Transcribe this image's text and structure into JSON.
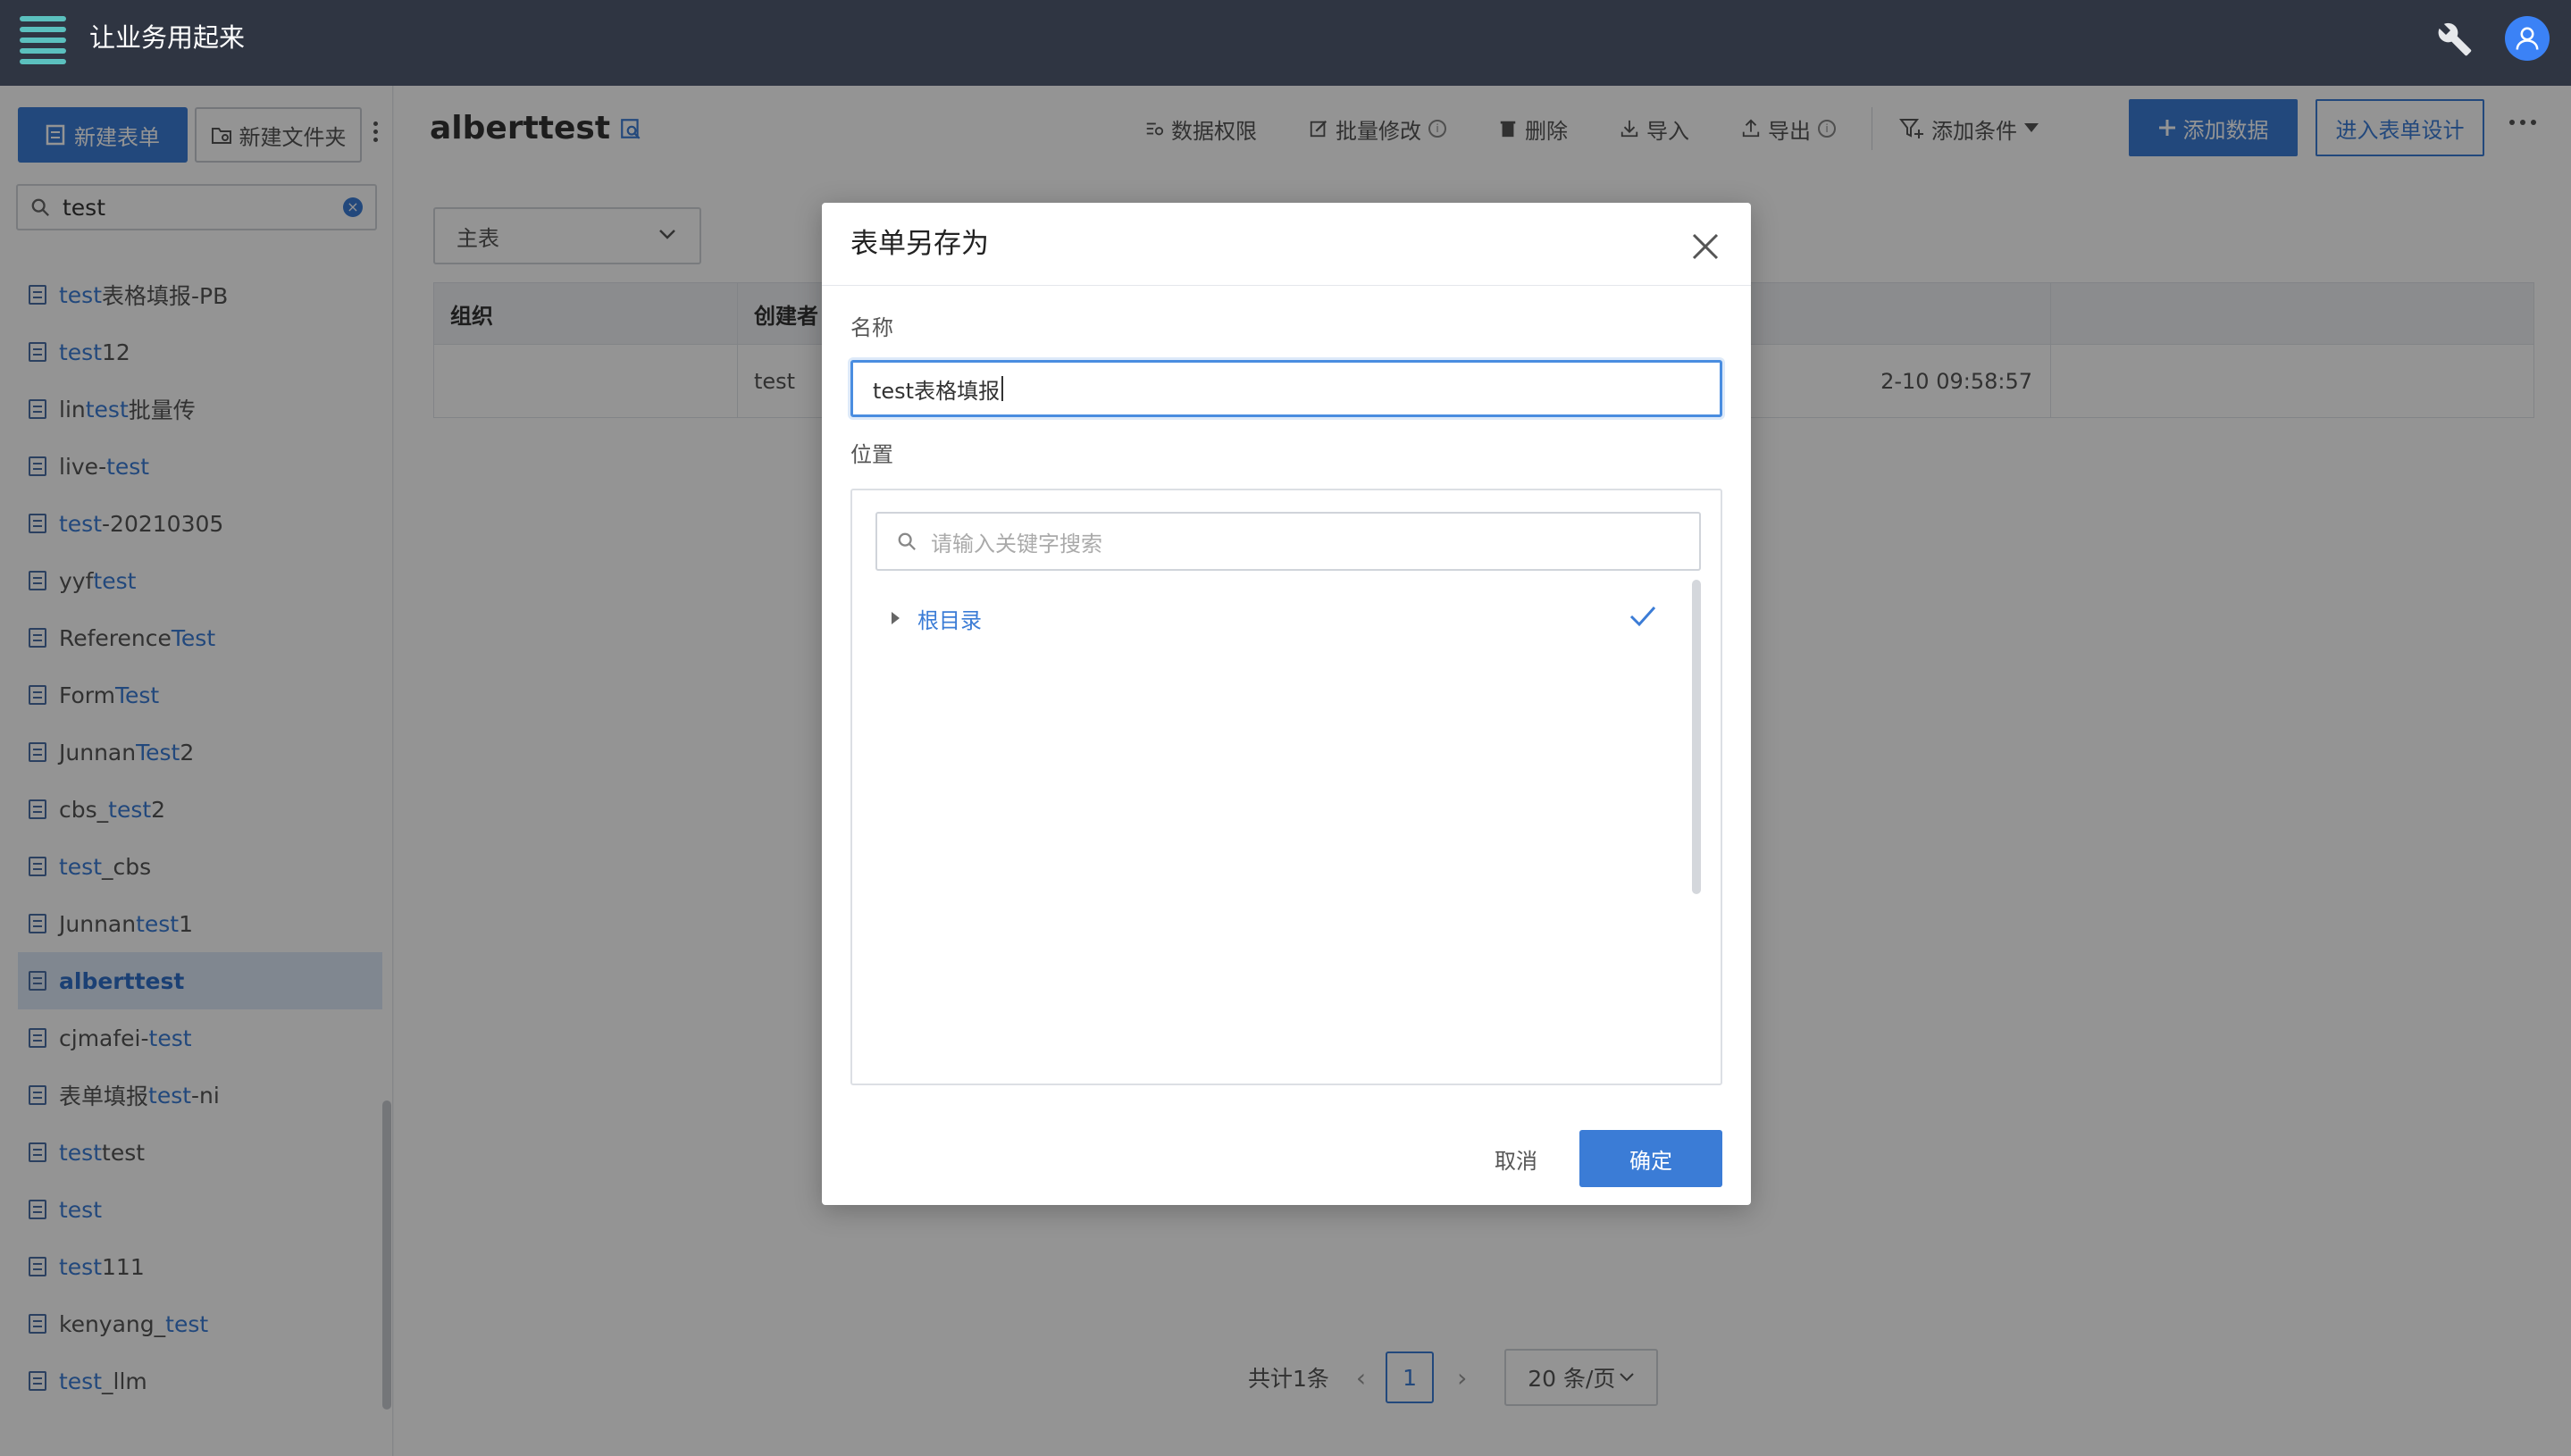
{
  "app": {
    "title": "让业务用起来",
    "wrench_icon": "wrench-icon",
    "avatar_icon": "user-avatar-icon"
  },
  "sidebar": {
    "new_form_label": "新建表单",
    "new_folder_label": "新建文件夹",
    "search_value": "test",
    "items": [
      {
        "pre": "",
        "hl": "test",
        "post": "表格填报-PB",
        "active": false
      },
      {
        "pre": "",
        "hl": "test",
        "post": "12",
        "active": false
      },
      {
        "pre": "lin",
        "hl": "test",
        "post": "批量传",
        "active": false
      },
      {
        "pre": "live-",
        "hl": "test",
        "post": "",
        "active": false
      },
      {
        "pre": "",
        "hl": "test",
        "post": "-20210305",
        "active": false
      },
      {
        "pre": "yyf",
        "hl": "test",
        "post": "",
        "active": false
      },
      {
        "pre": "Reference",
        "hl": "Test",
        "post": "",
        "active": false
      },
      {
        "pre": "Form",
        "hl": "Test",
        "post": "",
        "active": false
      },
      {
        "pre": "Junnan",
        "hl": "Test",
        "post": "2",
        "active": false
      },
      {
        "pre": "cbs_",
        "hl": "test",
        "post": "2",
        "active": false
      },
      {
        "pre": "",
        "hl": "test",
        "post": "_cbs",
        "active": false
      },
      {
        "pre": "Junnan",
        "hl": "test",
        "post": "1",
        "active": false
      },
      {
        "pre": "alberttest",
        "hl": "",
        "post": "",
        "active": true
      },
      {
        "pre": "cjmafei-",
        "hl": "test",
        "post": "",
        "active": false
      },
      {
        "pre": "表单填报",
        "hl": "test",
        "post": "-ni",
        "active": false
      },
      {
        "pre": "",
        "hl": "test",
        "post": "test",
        "active": false
      },
      {
        "pre": "",
        "hl": "test",
        "post": "",
        "active": false
      },
      {
        "pre": "",
        "hl": "test",
        "post": "111",
        "active": false
      },
      {
        "pre": "kenyang_",
        "hl": "test",
        "post": "",
        "active": false
      },
      {
        "pre": "",
        "hl": "test",
        "post": "_llm",
        "active": false
      }
    ]
  },
  "main": {
    "title": "alberttest",
    "toolbar": {
      "permissions": "数据权限",
      "batch_edit": "批量修改",
      "delete": "删除",
      "import": "导入",
      "export": "导出",
      "add_condition": "添加条件",
      "add_data": "添加数据",
      "enter_design": "进入表单设计"
    },
    "sheet_select": "主表",
    "table": {
      "headers": [
        "组织",
        "创建者",
        "",
        ""
      ],
      "rows": [
        [
          "",
          "test",
          "2-10 09:58:57",
          ""
        ]
      ]
    },
    "pager": {
      "total": "共计1条",
      "current_page": "1",
      "page_size": "20 条/页"
    }
  },
  "dialog": {
    "title": "表单另存为",
    "name_label": "名称",
    "name_value": "test表格填报",
    "location_label": "位置",
    "location_search_placeholder": "请输入关键字搜索",
    "tree_root": "根目录",
    "cancel": "取消",
    "ok": "确定"
  },
  "colors": {
    "primary": "#3b7cd6",
    "topbar": "#2f3542",
    "logo": "#5bc0be"
  }
}
